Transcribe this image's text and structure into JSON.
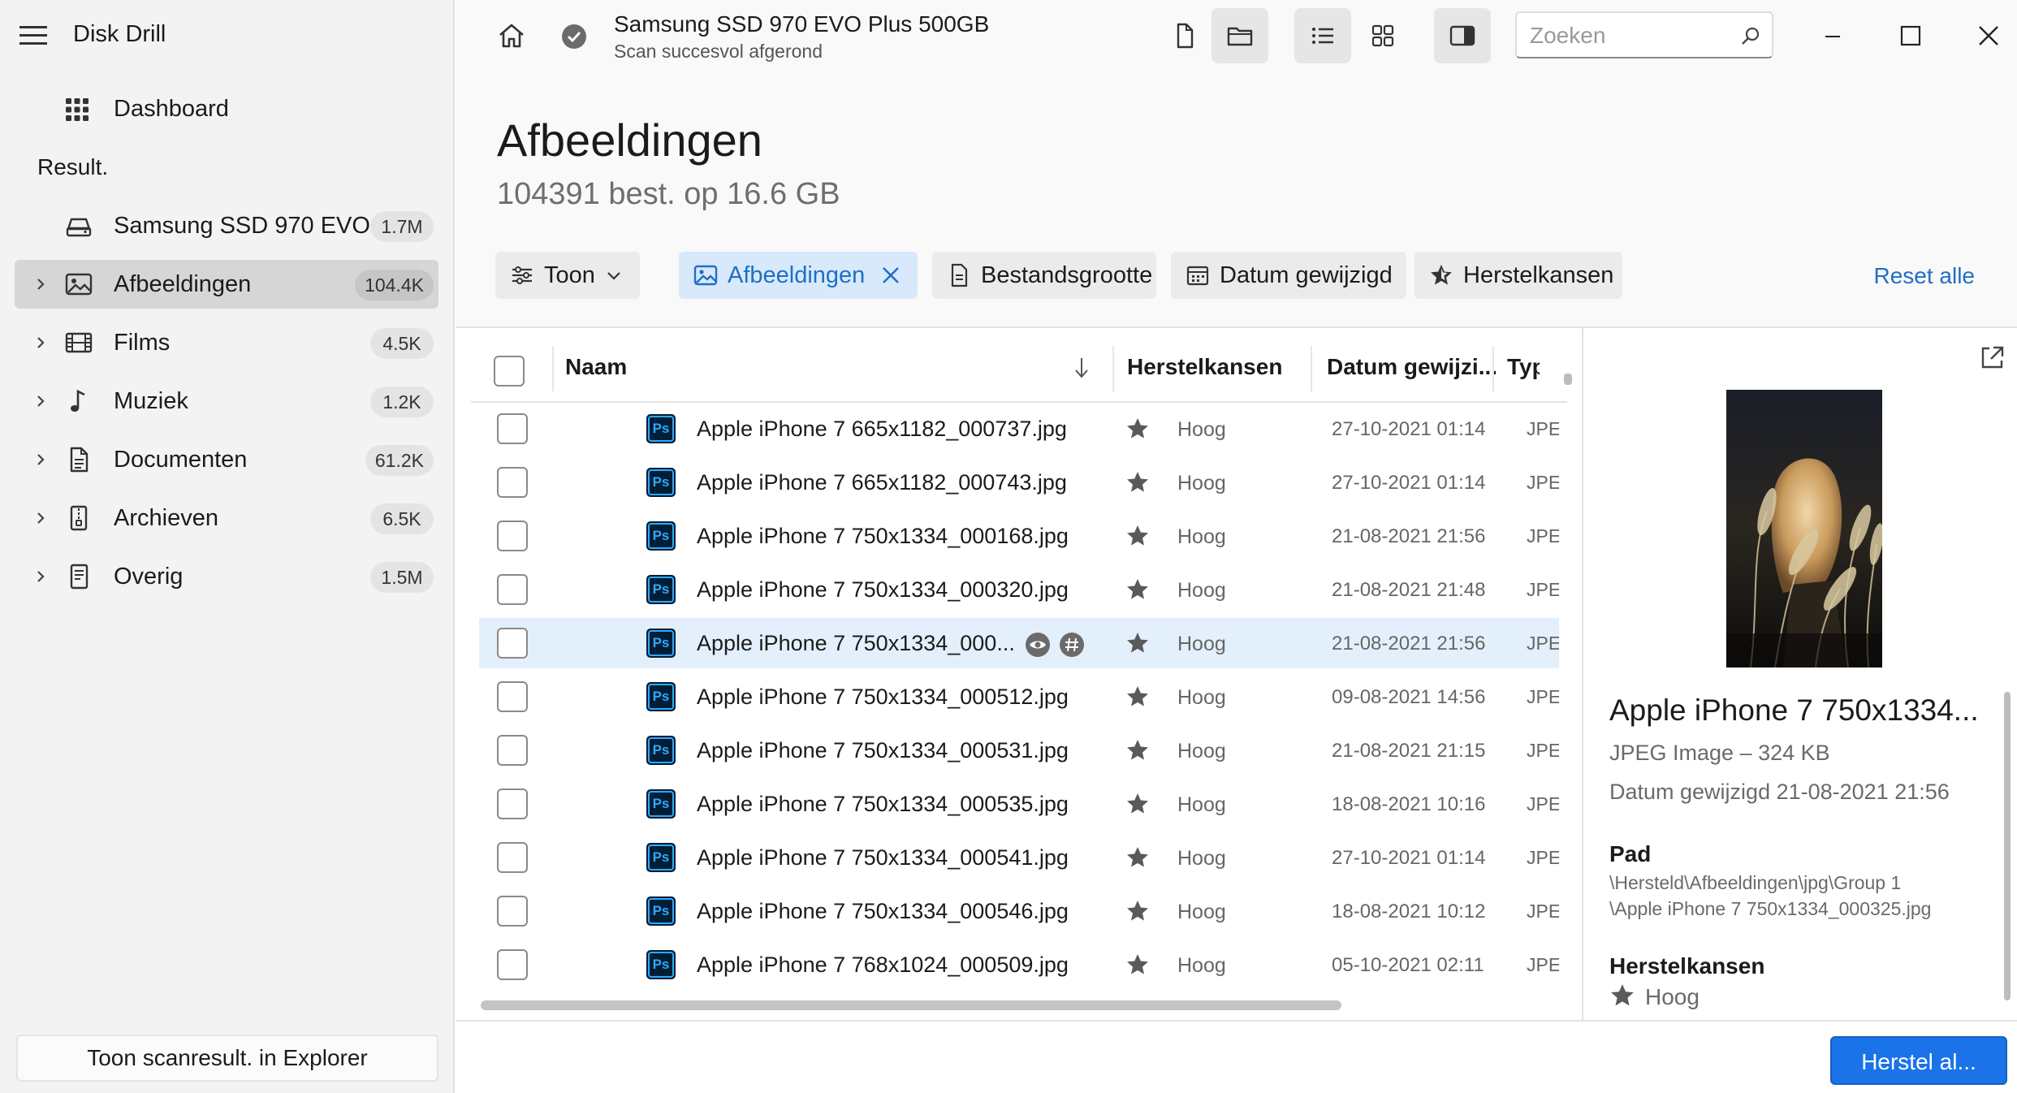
{
  "app": {
    "title": "Disk Drill"
  },
  "sidebar": {
    "dashboard_label": "Dashboard",
    "results_heading": "Result.",
    "items": [
      {
        "label": "Samsung SSD 970 EVO...",
        "count": "1.7M",
        "icon": "drive-icon"
      },
      {
        "label": "Afbeeldingen",
        "count": "104.4K",
        "icon": "image-icon"
      },
      {
        "label": "Films",
        "count": "4.5K",
        "icon": "film-icon"
      },
      {
        "label": "Muziek",
        "count": "1.2K",
        "icon": "music-icon"
      },
      {
        "label": "Documenten",
        "count": "61.2K",
        "icon": "document-icon"
      },
      {
        "label": "Archieven",
        "count": "6.5K",
        "icon": "archive-icon"
      },
      {
        "label": "Overig",
        "count": "1.5M",
        "icon": "other-icon"
      }
    ],
    "explorer_button": "Toon scanresult. in Explorer"
  },
  "topbar": {
    "device_name": "Samsung SSD 970 EVO Plus 500GB",
    "device_status": "Scan succesvol afgerond",
    "search_placeholder": "Zoeken"
  },
  "content": {
    "title": "Afbeeldingen",
    "subtitle": "104391 best. op 16.6 GB",
    "filters": {
      "view": "Toon",
      "type": "Afbeeldingen",
      "size": "Bestandsgrootte",
      "date": "Datum gewijzigd",
      "chance": "Herstelkansen"
    },
    "reset_all": "Reset alle"
  },
  "table": {
    "columns": {
      "name": "Naam",
      "chance": "Herstelkansen",
      "date": "Datum gewijzi...",
      "type": "Typ"
    },
    "rows": [
      {
        "name": "Apple iPhone 7 665x1182_000737.jpg",
        "chance": "Hoog",
        "date": "27-10-2021 01:14",
        "type": "JPE"
      },
      {
        "name": "Apple iPhone 7 665x1182_000743.jpg",
        "chance": "Hoog",
        "date": "27-10-2021 01:14",
        "type": "JPE"
      },
      {
        "name": "Apple iPhone 7 750x1334_000168.jpg",
        "chance": "Hoog",
        "date": "21-08-2021 21:56",
        "type": "JPE"
      },
      {
        "name": "Apple iPhone 7 750x1334_000320.jpg",
        "chance": "Hoog",
        "date": "21-08-2021 21:48",
        "type": "JPE"
      },
      {
        "name": "Apple iPhone 7 750x1334_000...",
        "chance": "Hoog",
        "date": "21-08-2021 21:56",
        "type": "JPE",
        "hovered": true
      },
      {
        "name": "Apple iPhone 7 750x1334_000512.jpg",
        "chance": "Hoog",
        "date": "09-08-2021 14:56",
        "type": "JPE"
      },
      {
        "name": "Apple iPhone 7 750x1334_000531.jpg",
        "chance": "Hoog",
        "date": "21-08-2021 21:15",
        "type": "JPE"
      },
      {
        "name": "Apple iPhone 7 750x1334_000535.jpg",
        "chance": "Hoog",
        "date": "18-08-2021 10:16",
        "type": "JPE"
      },
      {
        "name": "Apple iPhone 7 750x1334_000541.jpg",
        "chance": "Hoog",
        "date": "27-10-2021 01:14",
        "type": "JPE"
      },
      {
        "name": "Apple iPhone 7 750x1334_000546.jpg",
        "chance": "Hoog",
        "date": "18-08-2021 10:12",
        "type": "JPE"
      },
      {
        "name": "Apple iPhone 7 768x1024_000509.jpg",
        "chance": "Hoog",
        "date": "05-10-2021 02:11",
        "type": "JPE"
      }
    ],
    "file_icon_text": "Ps"
  },
  "preview": {
    "name": "Apple iPhone 7 750x1334...",
    "type_size": "JPEG Image – 324 KB",
    "date_modified": "Datum gewijzigd 21-08-2021 21:56",
    "path_heading": "Pad",
    "path_line1": "\\Hersteld\\Afbeeldingen\\jpg\\Group 1",
    "path_line2": "\\Apple iPhone 7 750x1334_000325.jpg",
    "chance_heading": "Herstelkansen",
    "chance_value": "Hoog"
  },
  "footer": {
    "recover_button": "Herstel al..."
  },
  "colors": {
    "accent": "#1a73e8",
    "link": "#1f6fc5",
    "selected_filter_bg": "#d8e9fb",
    "row_hover": "#e3f0fc",
    "sidebar_bg": "#f3f3f3",
    "photoshop_badge_bg": "#001e36",
    "photoshop_badge_fg": "#31a8ff"
  }
}
